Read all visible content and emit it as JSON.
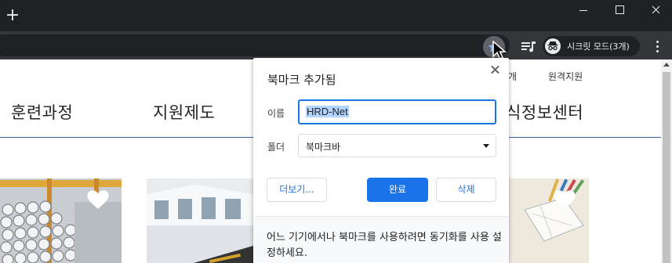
{
  "browser": {
    "new_tab_symbol": "+",
    "incognito_label": "시크릿 모드(3개)",
    "accent": "#1a73e8"
  },
  "site": {
    "util_links": [
      "개",
      "원격지원"
    ],
    "menu": [
      "훈련과정",
      "지원제도",
      "식정보센터"
    ]
  },
  "bookmark_bubble": {
    "title": "북마크 추가됨",
    "name_label": "이름",
    "name_value": "HRD-Net",
    "folder_label": "폴더",
    "folder_value": "북마크바",
    "more_button": "더보기...",
    "done_button": "완료",
    "remove_button": "삭제",
    "sync_message": "어느 기기에서나 북마크를 사용하려면 동기화를 사용 설정하세요."
  },
  "icons": [
    "close-icon",
    "star-icon",
    "media-control-icon",
    "incognito-icon",
    "more-vert-icon",
    "heart-icon",
    "chevron-down-icon"
  ]
}
